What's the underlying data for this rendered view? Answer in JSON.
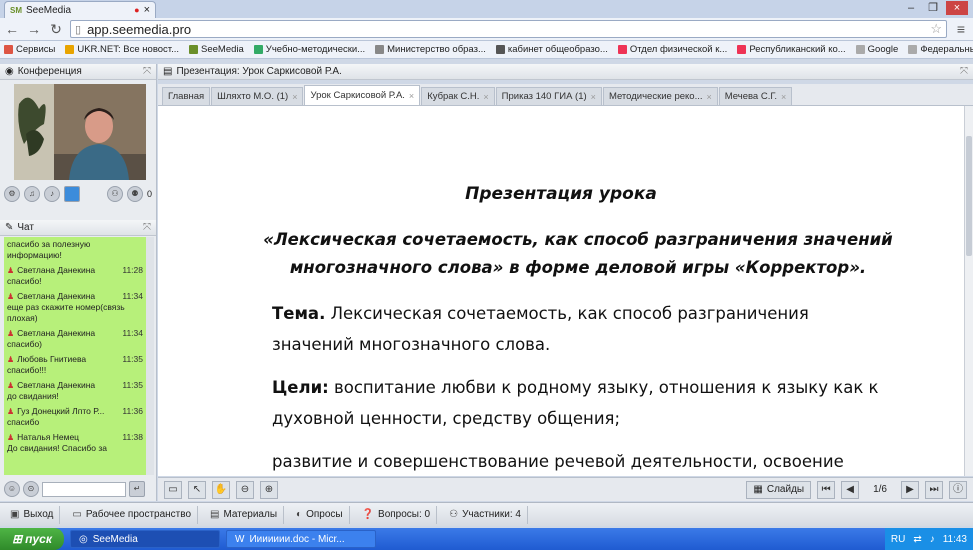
{
  "browser": {
    "tab_title": "SeeMedia",
    "tab_favicon": "SM",
    "url": "app.seemedia.pro",
    "bookmarks": [
      {
        "label": "Сервисы",
        "color": "#d54"
      },
      {
        "label": "UKR.NET: Все новост...",
        "color": "#e8a400"
      },
      {
        "label": "SeeMedia",
        "color": "#6a8f2a"
      },
      {
        "label": "Учебно-методически...",
        "color": "#3a6"
      },
      {
        "label": "Министерство образ...",
        "color": "#888"
      },
      {
        "label": "кабинет общеобразо...",
        "color": "#555"
      },
      {
        "label": "Отдел физической к...",
        "color": "#e35"
      },
      {
        "label": "Республиканский ко...",
        "color": "#e35"
      },
      {
        "label": "Google",
        "color": "#aaa"
      },
      {
        "label": "Федеральный Инсти...",
        "color": "#aaa"
      }
    ]
  },
  "left": {
    "conference_title": "Конференция",
    "participants_count": "0",
    "chat_title": "Чат",
    "messages": [
      {
        "author": "",
        "time": "",
        "text": "спасибо за полезную информацию!"
      },
      {
        "author": "Светлана Данекина",
        "time": "11:28",
        "text": "спасибо!"
      },
      {
        "author": "Светлана Данекина",
        "time": "11:34",
        "text": "еще раз скажите номер(связь плохая)"
      },
      {
        "author": "Светлана Данекина",
        "time": "11:34",
        "text": "спасибо)"
      },
      {
        "author": "Любовь Гнитиева",
        "time": "11:35",
        "text": "спасибо!!!"
      },
      {
        "author": "Светлана Данекина",
        "time": "11:35",
        "text": "до свидания!"
      },
      {
        "author": "Гуз Донецкий Лпто Р...",
        "time": "11:36",
        "text": "спасибо"
      },
      {
        "author": "Наталья Немец",
        "time": "11:38",
        "text": "До свидания! Спасибо за"
      }
    ]
  },
  "right": {
    "header": "Презентация: Урок Саркисовой Р.А.",
    "tabs": [
      {
        "label": "Главная",
        "active": false,
        "closable": false
      },
      {
        "label": "Шляхто М.О. (1)",
        "active": false,
        "closable": true
      },
      {
        "label": "Урок Саркисовой Р.А.",
        "active": true,
        "closable": true
      },
      {
        "label": "Кубрак С.Н.",
        "active": false,
        "closable": true
      },
      {
        "label": "Приказ 140 ГИА (1)",
        "active": false,
        "closable": true
      },
      {
        "label": "Методические реко...",
        "active": false,
        "closable": true
      },
      {
        "label": "Мечева С.Г.",
        "active": false,
        "closable": true
      }
    ],
    "doc": {
      "heading": "Презентация урока",
      "subtitle_line1": "«Лексическая сочетаемость, как способ разграничения значений",
      "subtitle_line2": "многозначного слова»  в форме деловой игры «Корректор».",
      "topic_label": "Тема.",
      "topic_line1": " Лексическая сочетаемость, как способ разграничения",
      "topic_line2": "значений многозначного слова.",
      "goals_label": "Цели:",
      "goals_line1": " воспитание любви к родному языку, отношения к языку как к",
      "goals_line2": "духовной ценности, средству общения;",
      "dev_line": "развитие и совершенствование речевой деятельности, освоение"
    },
    "slides_label": "Слайды",
    "page_indicator": "1/6"
  },
  "appbar": {
    "exit": "Выход",
    "workspace": "Рабочее пространство",
    "materials": "Материалы",
    "polls": "Опросы",
    "questions": "Вопросы: 0",
    "participants": "Участники: 4"
  },
  "taskbar": {
    "start": "пуск",
    "tasks": [
      "SeeMedia",
      "Иииииии.doc - Micr..."
    ],
    "lang": "RU",
    "clock": "11:43"
  }
}
